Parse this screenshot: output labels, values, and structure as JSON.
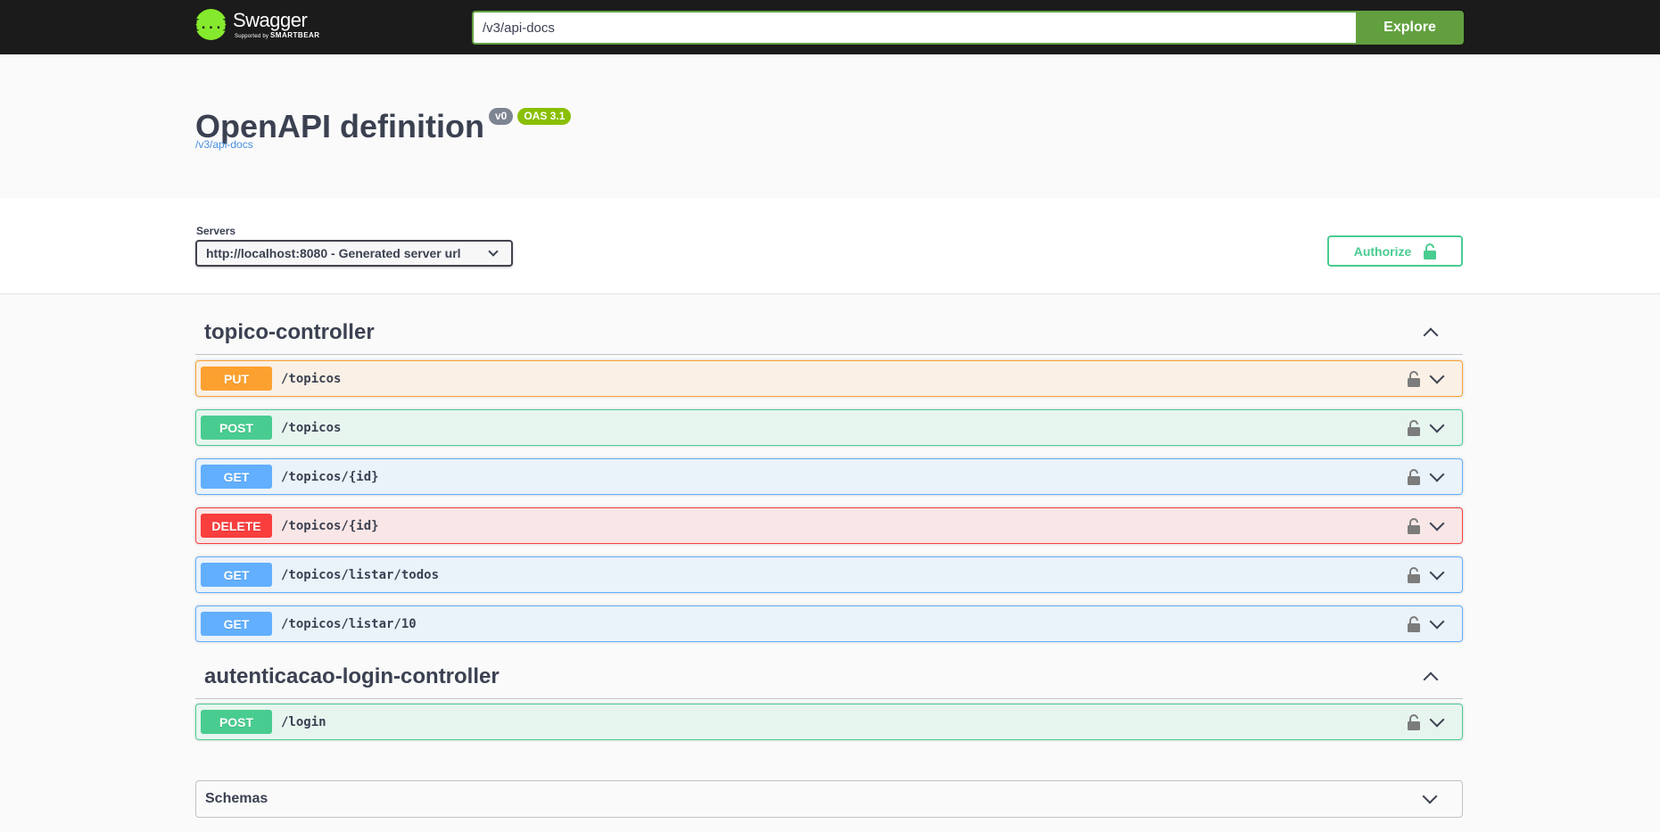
{
  "topbar": {
    "logo_icon": "{...}",
    "logo_name": "Swagger",
    "logo_supported": "Supported by",
    "logo_brand": "SMARTBEAR",
    "url_value": "/v3/api-docs",
    "explore_label": "Explore"
  },
  "info": {
    "title": "OpenAPI definition",
    "version": "v0",
    "oas": "OAS 3.1",
    "link": "/v3/api-docs"
  },
  "scheme": {
    "servers_label": "Servers",
    "server_selected": "http://localhost:8080 - Generated server url",
    "authorize_label": "Authorize"
  },
  "tags": [
    {
      "name": "topico-controller",
      "operations": [
        {
          "method": "PUT",
          "path": "/topicos"
        },
        {
          "method": "POST",
          "path": "/topicos"
        },
        {
          "method": "GET",
          "path": "/topicos/{id}"
        },
        {
          "method": "DELETE",
          "path": "/topicos/{id}"
        },
        {
          "method": "GET",
          "path": "/topicos/listar/todos"
        },
        {
          "method": "GET",
          "path": "/topicos/listar/10"
        }
      ]
    },
    {
      "name": "autenticacao-login-controller",
      "operations": [
        {
          "method": "POST",
          "path": "/login"
        }
      ]
    }
  ],
  "schemas": {
    "title": "Schemas"
  },
  "icons": {
    "logo": "swagger-logo-icon",
    "lock": "unlocked-padlock-icon",
    "expand": "chevron-down-icon",
    "collapse": "chevron-up-icon"
  },
  "colors": {
    "topbar": "#1b1b1b",
    "logo": "#85ea2d",
    "explore": "#62a03f",
    "put": "#fca130",
    "post": "#49cc90",
    "get": "#61affe",
    "delete": "#f93e3e",
    "version_badge": "#7d8492",
    "oas_badge": "#89bf04",
    "link": "#4990e2"
  }
}
